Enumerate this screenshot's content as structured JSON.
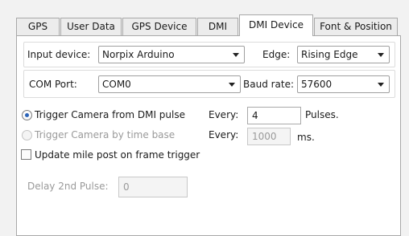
{
  "tabs": [
    {
      "label": "GPS"
    },
    {
      "label": "User Data"
    },
    {
      "label": "GPS Device"
    },
    {
      "label": "DMI"
    },
    {
      "label": "DMI Device"
    },
    {
      "label": "Font & Position"
    }
  ],
  "input_device": {
    "label": "Input device:",
    "value": "Norpix Arduino"
  },
  "edge": {
    "label": "Edge:",
    "value": "Rising Edge"
  },
  "com_port": {
    "label": "COM Port:",
    "value": "COM0"
  },
  "baud_rate": {
    "label": "Baud rate:",
    "value": "57600"
  },
  "trigger_dmi": {
    "label": "Trigger Camera from DMI pulse",
    "checked": true,
    "every_label": "Every:",
    "value": "4",
    "unit": "Pulses."
  },
  "trigger_time": {
    "label": "Trigger Camera by time base",
    "checked": false,
    "enabled": false,
    "every_label": "Every:",
    "value": "1000",
    "unit": "ms."
  },
  "update_mile_post": {
    "label": "Update mile post on frame trigger",
    "checked": false
  },
  "delay_2nd_pulse": {
    "label": "Delay 2nd Pulse:",
    "value": "0"
  },
  "colors": {
    "radio_dot": "#2a63b8",
    "disabled_text": "#9a9a9a"
  }
}
